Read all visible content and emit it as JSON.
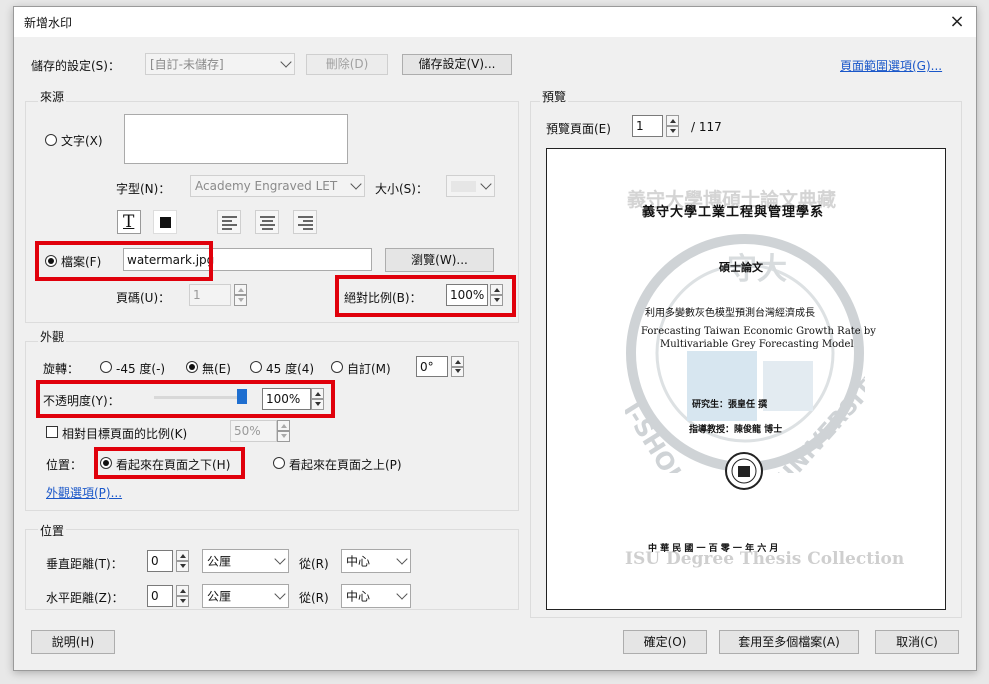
{
  "dialog": {
    "title": "新增水印",
    "close_icon": "×"
  },
  "saved_settings": {
    "label": "儲存的設定(S)：",
    "value": "[自訂-未儲存]",
    "delete_label": "刪除(D)",
    "save_label": "儲存設定(V)..."
  },
  "page_range_link": "頁面範圍選項(G)...",
  "source": {
    "group_label": "來源",
    "text_label": "文字(X)",
    "font_label": "字型(N)：",
    "font_value": "Academy Engraved LET",
    "size_label": "大小(S)：",
    "text_style_icon": "T",
    "file_label": "檔案(F)",
    "file_value": "watermark.jpg",
    "browse_label": "瀏覽(W)...",
    "page_label": "頁碼(U)：",
    "page_value": "1",
    "scale_label": "絕對比例(B)：",
    "scale_value": "100%"
  },
  "appearance": {
    "group_label": "外觀",
    "rotation_label": "旋轉：",
    "rot_m45": "-45 度(-)",
    "rot_none": "無(E)",
    "rot_45": "45 度(4)",
    "rot_custom": "自訂(M)",
    "rot_custom_value": "0°",
    "opacity_label": "不透明度(Y)：",
    "opacity_value": "100%",
    "opacity_level": 1.0,
    "relative_label": "相對目標頁面的比例(K)",
    "relative_value": "50%",
    "position_label": "位置：",
    "behind_label": "看起來在頁面之下(H)",
    "front_label": "看起來在頁面之上(P)",
    "options_link": "外觀選項(P)..."
  },
  "position": {
    "group_label": "位置",
    "vertical_label": "垂直距離(T)：",
    "vertical_value": "0",
    "vertical_unit": "公厘",
    "vertical_from_label": "從(R)",
    "vertical_from": "中心",
    "horizontal_label": "水平距離(Z)：",
    "horizontal_value": "0",
    "horizontal_unit": "公厘",
    "horizontal_from_label": "從(R)",
    "horizontal_from": "中心"
  },
  "preview": {
    "group_label": "預覽",
    "page_label": "預覽頁面(E)",
    "page_value": "1",
    "page_total": "/ 117",
    "doc": {
      "watermark_top": "義守大學博碩士論文典藏",
      "university": "義守大學工業工程與管理學系",
      "thesis_type": "碩士論文",
      "title_zh": "利用多變數灰色模型預測台灣經濟成長",
      "title_en_1": "Forecasting Taiwan Economic Growth Rate by",
      "title_en_2": "Multivariable Grey Forecasting Model",
      "student": "研究生：張皇任 撰",
      "advisor": "指導教授：陳俊龍 博士",
      "date": "中 華 民 國 一 百 零 一 年 六 月",
      "watermark_bottom": "ISU Degree Thesis Collection",
      "watermark_arc_left": "I-SHOU",
      "watermark_arc_right": "UNIVERSITY",
      "watermark_center": "守大"
    }
  },
  "footer": {
    "help_label": "說明(H)",
    "ok_label": "確定(O)",
    "apply_multi_label": "套用至多個檔案(A)",
    "cancel_label": "取消(C)"
  },
  "colors": {
    "highlight": "#e0000b",
    "link": "#1a57c9",
    "slider_thumb": "#1f6fd0"
  }
}
